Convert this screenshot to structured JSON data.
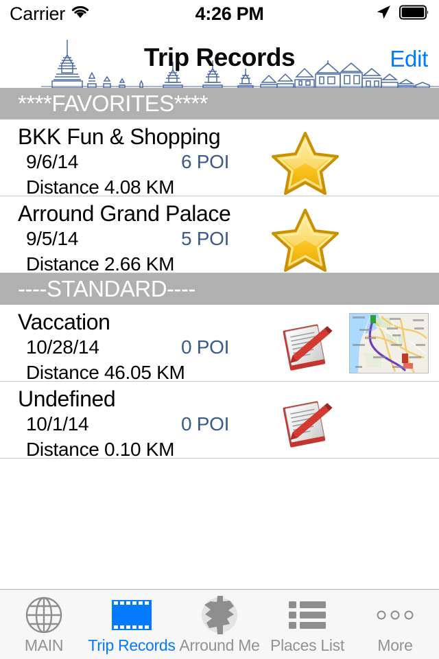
{
  "status_bar": {
    "carrier": "Carrier",
    "wifi_icon": "wifi-icon",
    "time": "4:26 PM",
    "location_icon": "location-arrow-icon",
    "battery_icon": "battery-full-icon"
  },
  "nav_bar": {
    "title": "Trip Records",
    "edit_label": "Edit",
    "background_art": "bangkok-skyline-illustration",
    "art_color": "#4a6aa5",
    "edit_color": "#007aff"
  },
  "colors": {
    "section_header_bg": "#b0b0b0",
    "section_header_text": "#ffffff",
    "poi_text": "#3b5a8a",
    "tab_active": "#047aff",
    "tab_inactive": "#929292",
    "separator": "#c8c7cc",
    "star_gold": "#f5c518",
    "route_purple": "#6f3fbf"
  },
  "sections": [
    {
      "header": "****FAVORITES****",
      "rows": [
        {
          "title": "BKK Fun & Shopping",
          "date": "9/6/14",
          "poi": "6 POI",
          "distance": "Distance 4.08 KM",
          "icon": "gold-star-icon",
          "has_map": false
        },
        {
          "title": "Arround Grand Palace",
          "date": "9/5/14",
          "poi": "5 POI",
          "distance": "Distance 2.66 KM",
          "icon": "gold-star-icon",
          "has_map": false
        }
      ]
    },
    {
      "header": "----STANDARD----",
      "rows": [
        {
          "title": "Vaccation",
          "date": "10/28/14",
          "poi": "0 POI",
          "distance": "Distance 46.05 KM",
          "icon": "notepad-pencil-icon",
          "has_map": true,
          "map_thumbnail": "route-map-thumbnail"
        },
        {
          "title": "Undefined",
          "date": "10/1/14",
          "poi": "0 POI",
          "distance": "Distance 0.10 KM",
          "icon": "notepad-pencil-icon",
          "has_map": false
        }
      ]
    }
  ],
  "tab_bar": {
    "tabs": [
      {
        "label": "MAIN",
        "icon": "globe-icon",
        "active": false
      },
      {
        "label": "Trip Records",
        "icon": "film-strip-icon",
        "active": true
      },
      {
        "label": "Arround Me",
        "icon": "map-pin-region-icon",
        "active": false
      },
      {
        "label": "Places List",
        "icon": "list-icon",
        "active": false
      },
      {
        "label": "More",
        "icon": "more-dots-icon",
        "active": false
      }
    ]
  }
}
